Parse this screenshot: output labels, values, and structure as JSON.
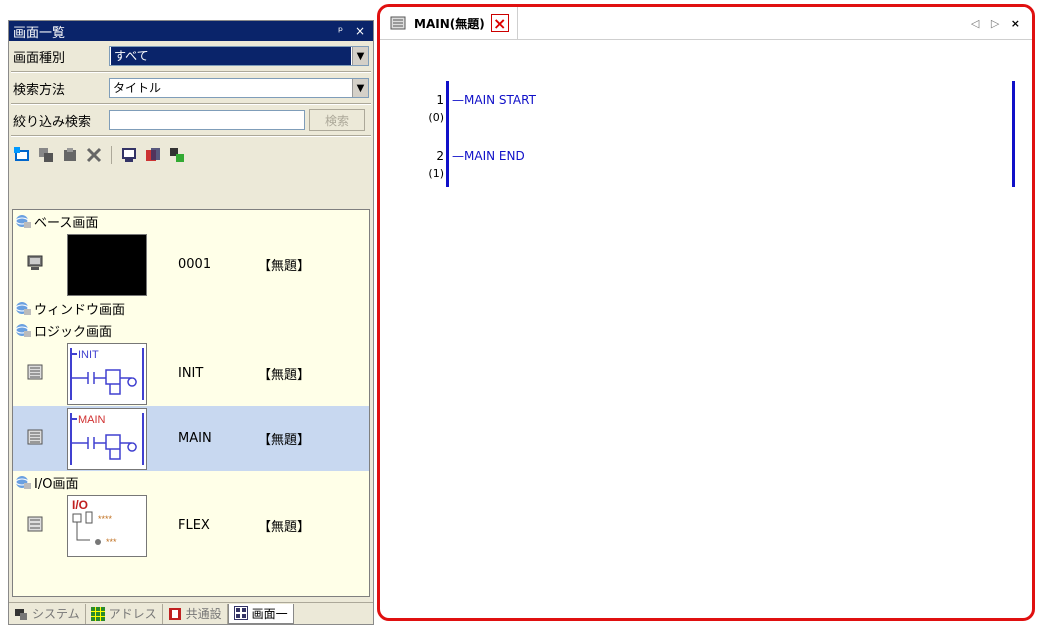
{
  "left_panel": {
    "title": "画面一覧",
    "title_buttons": "ᵖ ×",
    "screen_type_label": "画面種別",
    "screen_type_value": "すべて",
    "search_method_label": "検索方法",
    "search_method_value": "タイトル",
    "filter_label": "絞り込み検索",
    "search_button": "検索",
    "categories": {
      "base": "ベース画面",
      "window": "ウィンドウ画面",
      "logic": "ロジック画面",
      "io": "I/O画面"
    },
    "items": [
      {
        "number": "0001",
        "title": "【無題】",
        "thumb_label": ""
      },
      {
        "number": "INIT",
        "title": "【無題】",
        "thumb_label": "INIT"
      },
      {
        "number": "MAIN",
        "title": "【無題】",
        "thumb_label": "MAIN"
      },
      {
        "number": "FLEX",
        "title": "【無題】",
        "thumb_label": "I/O"
      }
    ],
    "thumb_io_rows": [
      "****",
      "***"
    ]
  },
  "bottom_tabs": [
    {
      "label": "システム"
    },
    {
      "label": "アドレス"
    },
    {
      "label": "共通設"
    },
    {
      "label": "画面一"
    }
  ],
  "editor": {
    "tab_label": "MAIN(無題)",
    "close_glyph": "×",
    "nav_glyphs": "◁ ▷",
    "close_all": "×",
    "rungs": [
      {
        "number": "1",
        "position": "(0)",
        "text": "MAIN START"
      },
      {
        "number": "2",
        "position": "(1)",
        "text": "MAIN END"
      }
    ]
  },
  "colors": {
    "accent_red": "#e01010",
    "ladder_blue": "#1010c8",
    "title_navy": "#0a246a",
    "selection": "#c8d8f0"
  }
}
